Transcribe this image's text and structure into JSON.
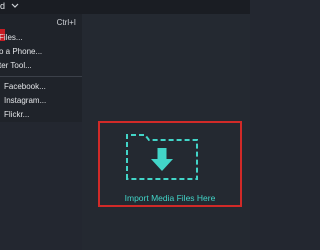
{
  "topbar": {
    "menu_label": "d"
  },
  "dropdown": {
    "items": [
      {
        "label": "",
        "shortcut": "Ctrl+I"
      },
      {
        "label": "Files..."
      },
      {
        "label": "o a Phone..."
      },
      {
        "label": "ter Tool..."
      },
      {
        "label": "Facebook..."
      },
      {
        "label": "Instagram..."
      },
      {
        "label": "Flickr..."
      }
    ]
  },
  "import_area": {
    "label": "Import Media Files Here",
    "icon": "folder-download-icon"
  },
  "colors": {
    "accent": "#42d5c8",
    "highlight_border": "#d12a28",
    "background": "#232730",
    "menu_background": "#1f232a"
  }
}
